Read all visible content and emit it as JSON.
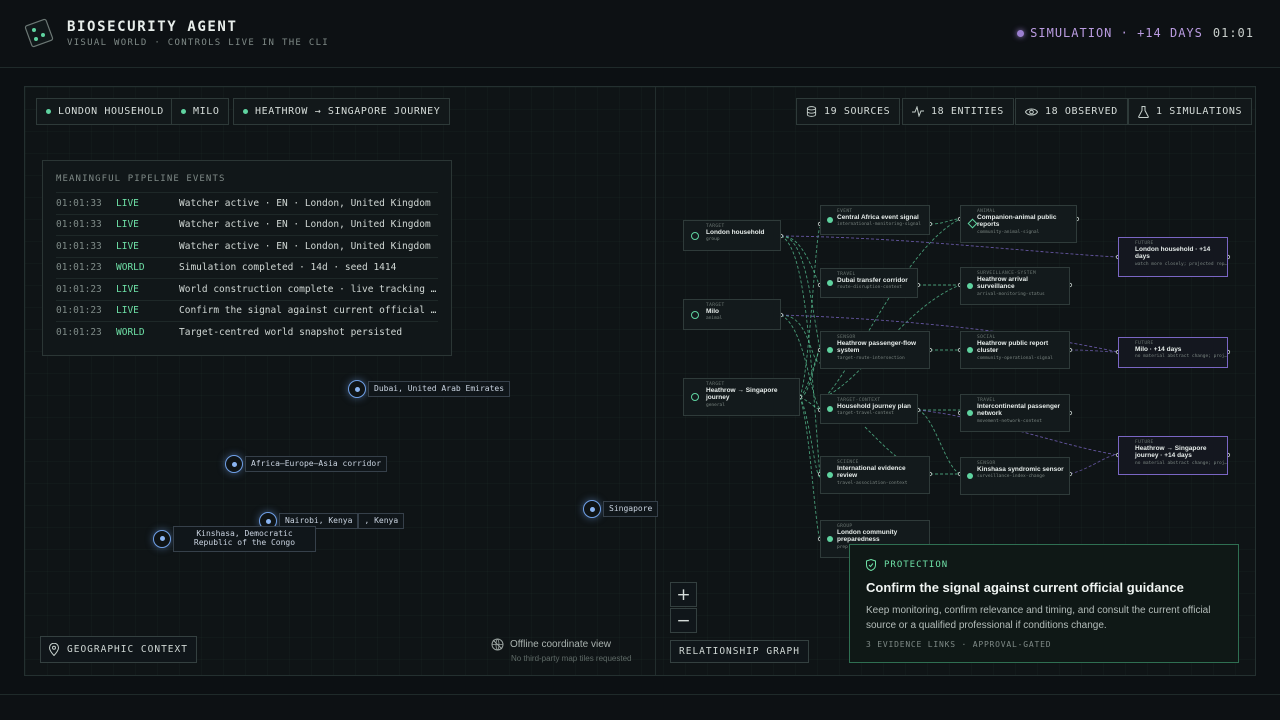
{
  "header": {
    "title": "BIOSECURITY AGENT",
    "subtitle": "VISUAL WORLD · CONTROLS LIVE IN THE CLI",
    "status": "SIMULATION · +14 DAYS",
    "clock": "01:01"
  },
  "targets": [
    "LONDON HOUSEHOLD",
    "MILO",
    "HEATHROW → SINGAPORE JOURNEY"
  ],
  "stats": {
    "sources": "19 SOURCES",
    "entities": "18 ENTITIES",
    "observed": "18 OBSERVED",
    "simulations": "1 SIMULATIONS"
  },
  "events": {
    "title": "MEANINGFUL PIPELINE EVENTS",
    "rows": [
      {
        "time": "01:01:33",
        "tag": "LIVE",
        "msg": "Watcher active · EN · London, United Kingdom"
      },
      {
        "time": "01:01:33",
        "tag": "LIVE",
        "msg": "Watcher active · EN · London, United Kingdom"
      },
      {
        "time": "01:01:33",
        "tag": "LIVE",
        "msg": "Watcher active · EN · London, United Kingdom"
      },
      {
        "time": "01:01:23",
        "tag": "WORLD",
        "msg": "Simulation completed · 14d · seed 1414"
      },
      {
        "time": "01:01:23",
        "tag": "LIVE",
        "msg": "World construction complete · live tracking ac…"
      },
      {
        "time": "01:01:23",
        "tag": "LIVE",
        "msg": "Confirm the signal against current official gu…"
      },
      {
        "time": "01:01:23",
        "tag": "WORLD",
        "msg": "Target-centred world snapshot persisted"
      }
    ]
  },
  "map": {
    "places": [
      "Dubai, United Arab Emirates",
      "Africa–Europe–Asia corridor",
      "Nairobi, Kenya",
      ", Kenya",
      "Singapore",
      "Kinshasa, Democratic Republic of the Congo"
    ],
    "geo_button": "GEOGRAPHIC CONTEXT",
    "offline_title": "Offline coordinate view",
    "offline_sub": "No third-party map tiles requested"
  },
  "graph": {
    "button": "RELATIONSHIP GRAPH",
    "zoom_in": "+",
    "zoom_out": "−",
    "nodes": {
      "t1": {
        "k": "TARGET",
        "t": "London household",
        "s": "group"
      },
      "t2": {
        "k": "TARGET",
        "t": "Milo",
        "s": "animal"
      },
      "t3": {
        "k": "TARGET",
        "t": "Heathrow → Singapore journey",
        "s": "general"
      },
      "c1": {
        "k": "EVENT",
        "t": "Central Africa event signal",
        "s": "international-monitoring-signal"
      },
      "c2": {
        "k": "TRAVEL",
        "t": "Dubai transfer corridor",
        "s": "route-disruption-context"
      },
      "c3": {
        "k": "SENSOR",
        "t": "Heathrow passenger-flow system",
        "s": "target-route-intersection"
      },
      "c4": {
        "k": "TARGET-CONTEXT",
        "t": "Household journey plan",
        "s": "target-travel-context"
      },
      "c5": {
        "k": "SCIENCE",
        "t": "International evidence review",
        "s": "travel-association-context"
      },
      "c6": {
        "k": "GROUP",
        "t": "London community preparedness",
        "s": "prep"
      },
      "d1": {
        "k": "ANIMAL",
        "t": "Companion-animal public reports",
        "s": "community-animal-signal"
      },
      "d2": {
        "k": "SURVEILLANCE-SYSTEM",
        "t": "Heathrow arrival surveillance",
        "s": "arrival-monitoring-status"
      },
      "d3": {
        "k": "SOCIAL",
        "t": "Heathrow public report cluster",
        "s": "community-operational-signal"
      },
      "d4": {
        "k": "TRAVEL",
        "t": "Intercontinental passenger network",
        "s": "movement-network-context"
      },
      "d5": {
        "k": "SENSOR",
        "t": "Kinshasa syndromic sensor",
        "s": "surveillance-index-change"
      },
      "f1": {
        "k": "FUTURE",
        "t": "London household · +14 days",
        "s": "watch more closely; projected rep…"
      },
      "f2": {
        "k": "FUTURE",
        "t": "Milo · +14 days",
        "s": "no material abstract change; proj…"
      },
      "f3": {
        "k": "FUTURE",
        "t": "Heathrow → Singapore journey · +14 days",
        "s": "no material abstract change; proj…"
      }
    }
  },
  "protection": {
    "kicker": "PROTECTION",
    "title": "Confirm the signal against current official guidance",
    "body": "Keep monitoring, confirm relevance and timing, and consult the current official source or a qualified professional if conditions change.",
    "meta": "3 EVIDENCE LINKS · APPROVAL-GATED"
  },
  "colors": {
    "accent": "#5fd3a0",
    "future": "#7a66c4",
    "map_marker": "#6f9fe6",
    "simulation": "#b99be0"
  }
}
